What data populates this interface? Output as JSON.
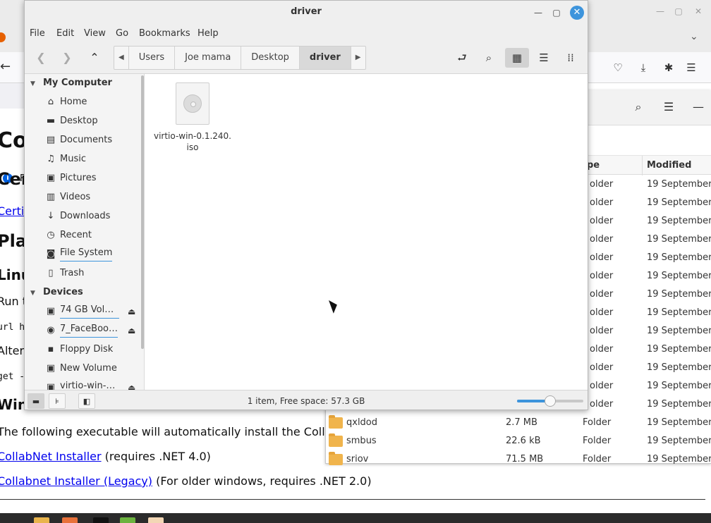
{
  "file_manager": {
    "title": "driver",
    "menu": [
      "File",
      "Edit",
      "View",
      "Go",
      "Bookmarks",
      "Help"
    ],
    "breadcrumbs": [
      "Users",
      "Joe mama",
      "Desktop",
      "driver"
    ],
    "active_crumb": "driver",
    "sidebar": {
      "my_computer_heading": "My Computer",
      "my_computer_items": [
        {
          "label": "Home",
          "icon": "home-icon"
        },
        {
          "label": "Desktop",
          "icon": "desktop-icon"
        },
        {
          "label": "Documents",
          "icon": "documents-icon"
        },
        {
          "label": "Music",
          "icon": "music-icon"
        },
        {
          "label": "Pictures",
          "icon": "pictures-icon"
        },
        {
          "label": "Videos",
          "icon": "videos-icon"
        },
        {
          "label": "Downloads",
          "icon": "downloads-icon"
        },
        {
          "label": "Recent",
          "icon": "recent-icon"
        },
        {
          "label": "File System",
          "icon": "filesystem-icon"
        },
        {
          "label": "Trash",
          "icon": "trash-icon"
        }
      ],
      "devices_heading": "Devices",
      "device_items": [
        {
          "label": "74 GB Volu…",
          "icon": "drive-icon",
          "ejectable": true
        },
        {
          "label": "7_FaceBoo…",
          "icon": "disc-icon",
          "ejectable": true
        },
        {
          "label": "Floppy Disk",
          "icon": "floppy-icon",
          "ejectable": false
        },
        {
          "label": "New Volume",
          "icon": "drive-icon",
          "ejectable": false
        },
        {
          "label": "virtio-win-0…",
          "icon": "drive-icon",
          "ejectable": true
        }
      ]
    },
    "files": [
      {
        "name_line1": "virtio-win-0.1.240.",
        "name_line2": "iso",
        "icon": "iso-disc-icon"
      }
    ],
    "status_text": "1 item, Free space: 57.3 GB",
    "zoom_level": 0.5
  },
  "list_window": {
    "columns": [
      "pe",
      "Modified"
    ],
    "rows": [
      {
        "name": "",
        "size": "",
        "type": "older",
        "modified": "19 September 2"
      },
      {
        "name": "",
        "size": "",
        "type": "older",
        "modified": "19 September 2"
      },
      {
        "name": "",
        "size": "",
        "type": "older",
        "modified": "19 September 2"
      },
      {
        "name": "",
        "size": "",
        "type": "older",
        "modified": "19 September 2"
      },
      {
        "name": "",
        "size": "",
        "type": "older",
        "modified": "19 September 2"
      },
      {
        "name": "",
        "size": "",
        "type": "older",
        "modified": "19 September 2"
      },
      {
        "name": "",
        "size": "",
        "type": "older",
        "modified": "19 September 2"
      },
      {
        "name": "",
        "size": "",
        "type": "older",
        "modified": "19 September 2"
      },
      {
        "name": "",
        "size": "",
        "type": "older",
        "modified": "19 September 2"
      },
      {
        "name": "",
        "size": "",
        "type": "older",
        "modified": "19 September 2"
      },
      {
        "name": "",
        "size": "",
        "type": "older",
        "modified": "19 September 2"
      },
      {
        "name": "",
        "size": "",
        "type": "older",
        "modified": "19 September 2"
      },
      {
        "name": "",
        "size": "",
        "type": "older",
        "modified": "19 September 2"
      },
      {
        "name": "qxldod",
        "size": "2.7 MB",
        "type": "Folder",
        "modified": "19 September 2"
      },
      {
        "name": "smbus",
        "size": "22.6 kB",
        "type": "Folder",
        "modified": "19 September 2"
      },
      {
        "name": "sriov",
        "size": "71.5 MB",
        "type": "Folder",
        "modified": "19 September 2"
      }
    ]
  },
  "browser_page": {
    "infobar_text": "F",
    "h1": "Co",
    "h2": "Cer",
    "link_certif": "Certif",
    "h2_pla": "Pla",
    "h3_linux": "Linu",
    "run_text": "Run t",
    "code1": "url h",
    "alt_text": "Altern",
    "code2": "get -",
    "h3_win": "Win",
    "exec_text": "The following executable will automatically install the Colla",
    "link_collabnet": "CollabNet Installer",
    "collabnet_req": " (requires .NET 4.0)",
    "link_legacy": "Collabnet Installer (Legacy)",
    "legacy_req": " (For older windows, requires .NET 2.0)"
  },
  "colors": {
    "accent": "#3d94dc",
    "folder": "#f0b44c",
    "link": "#0000ee"
  }
}
